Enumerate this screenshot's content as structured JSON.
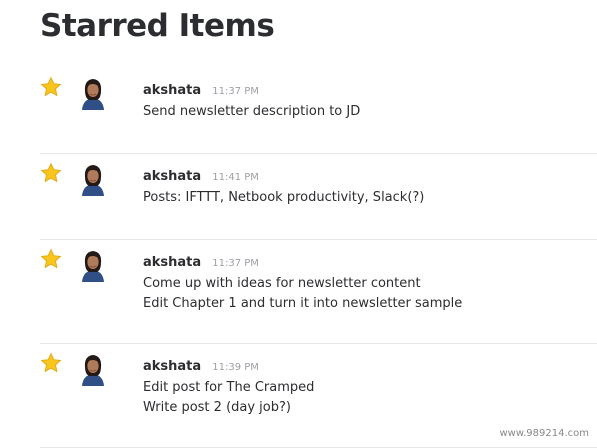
{
  "page": {
    "title": "Starred Items"
  },
  "colors": {
    "star": "#f8c51c",
    "star_outline": "#e2a814",
    "divider": "#e6e6e6",
    "timestamp": "#9e9ea6",
    "text": "#2c2d30"
  },
  "items": [
    {
      "author": "akshata",
      "time": "11:37 PM",
      "lines": [
        "Send newsletter description to JD"
      ],
      "starred": true,
      "star_icon": "star-icon",
      "avatar": "user-avatar"
    },
    {
      "author": "akshata",
      "time": "11:41 PM",
      "lines": [
        "Posts: IFTTT, Netbook productivity, Slack(?)"
      ],
      "starred": true,
      "star_icon": "star-icon",
      "avatar": "user-avatar"
    },
    {
      "author": "akshata",
      "time": "11:37 PM",
      "lines": [
        "Come up with ideas for newsletter content",
        "Edit Chapter 1 and turn it into newsletter sample"
      ],
      "starred": true,
      "star_icon": "star-icon",
      "avatar": "user-avatar"
    },
    {
      "author": "akshata",
      "time": "11:39 PM",
      "lines": [
        "Edit post for The Cramped",
        "Write post 2 (day job?)"
      ],
      "starred": true,
      "star_icon": "star-icon",
      "avatar": "user-avatar"
    }
  ],
  "watermark": "www.989214.com"
}
